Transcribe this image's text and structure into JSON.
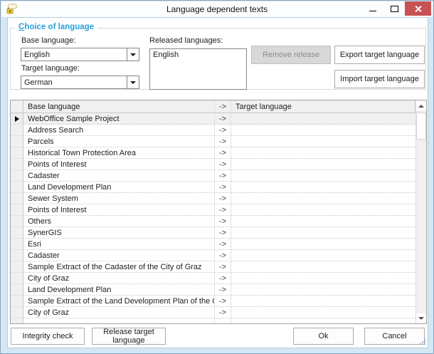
{
  "window": {
    "title": "Language dependent texts",
    "icon": "speech-bubble-lock-icon",
    "controls": [
      "minimize",
      "maximize",
      "close"
    ]
  },
  "choice_group": {
    "title": "Choice of language",
    "base_language_label": "Base language:",
    "base_language_value": "English",
    "target_language_label": "Target language:",
    "target_language_value": "German",
    "released_label": "Released languages:",
    "released_items_0": "English",
    "remove_release_label": "Remove release",
    "export_label": "Export target language",
    "import_label": "Import target language"
  },
  "table": {
    "columns": {
      "base": "Base language",
      "arrow": "->",
      "target": "Target language"
    },
    "arrow_label": "->",
    "rows": [
      {
        "base": "WebOffice Sample Project",
        "target": "",
        "selected": true
      },
      {
        "base": "Address Search",
        "target": "",
        "selected": false
      },
      {
        "base": "Parcels",
        "target": "",
        "selected": false
      },
      {
        "base": "Historical Town Protection Area",
        "target": "",
        "selected": false
      },
      {
        "base": "Points of Interest",
        "target": "",
        "selected": false
      },
      {
        "base": "Cadaster",
        "target": "",
        "selected": false
      },
      {
        "base": "Land Development Plan",
        "target": "",
        "selected": false
      },
      {
        "base": "Sewer System",
        "target": "",
        "selected": false
      },
      {
        "base": "Points of Interest",
        "target": "",
        "selected": false
      },
      {
        "base": "Others",
        "target": "",
        "selected": false
      },
      {
        "base": "SynerGIS",
        "target": "",
        "selected": false
      },
      {
        "base": "Esri",
        "target": "",
        "selected": false
      },
      {
        "base": "Cadaster",
        "target": "",
        "selected": false
      },
      {
        "base": "Sample Extract of the Cadaster of the City of Graz",
        "target": "",
        "selected": false
      },
      {
        "base": "City of Graz",
        "target": "",
        "selected": false
      },
      {
        "base": "Land Development Plan",
        "target": "",
        "selected": false
      },
      {
        "base": "Sample Extract of the Land Development Plan of the City of G...",
        "target": "",
        "selected": false
      },
      {
        "base": "City of Graz",
        "target": "",
        "selected": false
      }
    ]
  },
  "footer": {
    "integrity_label": "Integrity check",
    "release_label": "Release target language",
    "ok_label": "Ok",
    "cancel_label": "Cancel"
  },
  "colors": {
    "accent_blue": "#29a0d8",
    "close_red": "#c85153",
    "frame_blue": "#d6e7f4",
    "disabled_gray": "#d8d8d8",
    "header_gray": "#f0f0f0"
  }
}
